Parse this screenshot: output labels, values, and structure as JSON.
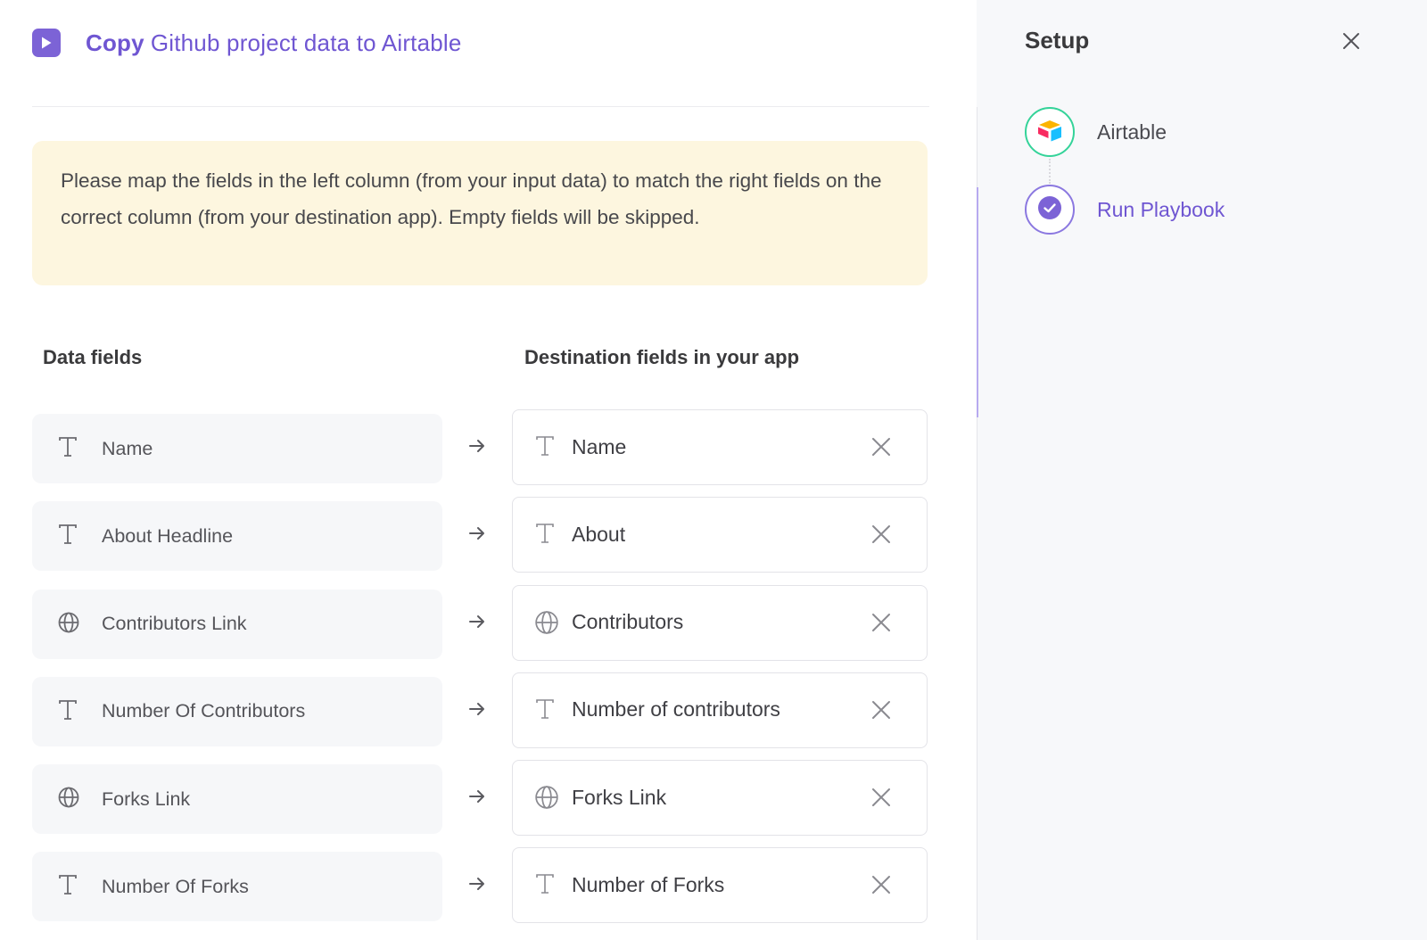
{
  "header": {
    "title_verb": "Copy",
    "title_rest": "Github project data to Airtable",
    "icon": "play-icon"
  },
  "notice": {
    "text": "Please map the fields in the left column (from your input data) to match the right fields on the correct column (from your destination app). Empty fields will be skipped."
  },
  "columns": {
    "left": "Data fields",
    "right": "Destination fields in your app"
  },
  "mappings": [
    {
      "source": "Name",
      "source_icon": "text-icon",
      "destination": "Name",
      "destination_icon": "text-icon"
    },
    {
      "source": "About Headline",
      "source_icon": "text-icon",
      "destination": "About",
      "destination_icon": "text-icon"
    },
    {
      "source": "Contributors Link",
      "source_icon": "globe-icon",
      "destination": "Contributors",
      "destination_icon": "globe-icon"
    },
    {
      "source": "Number Of Contributors",
      "source_icon": "text-icon",
      "destination": "Number of contributors",
      "destination_icon": "text-icon"
    },
    {
      "source": "Forks Link",
      "source_icon": "globe-icon",
      "destination": "Forks Link",
      "destination_icon": "globe-icon"
    },
    {
      "source": "Number Of Forks",
      "source_icon": "text-icon",
      "destination": "Number of Forks",
      "destination_icon": "text-icon"
    }
  ],
  "setup": {
    "title": "Setup",
    "steps": [
      {
        "label": "Airtable",
        "icon": "airtable-logo-icon",
        "status": "complete"
      },
      {
        "label": "Run Playbook",
        "icon": "check-circle-icon",
        "status": "current"
      }
    ]
  },
  "colors": {
    "accent": "#6f56d2",
    "notice_bg": "#fdf6df",
    "complete": "#34d399"
  }
}
